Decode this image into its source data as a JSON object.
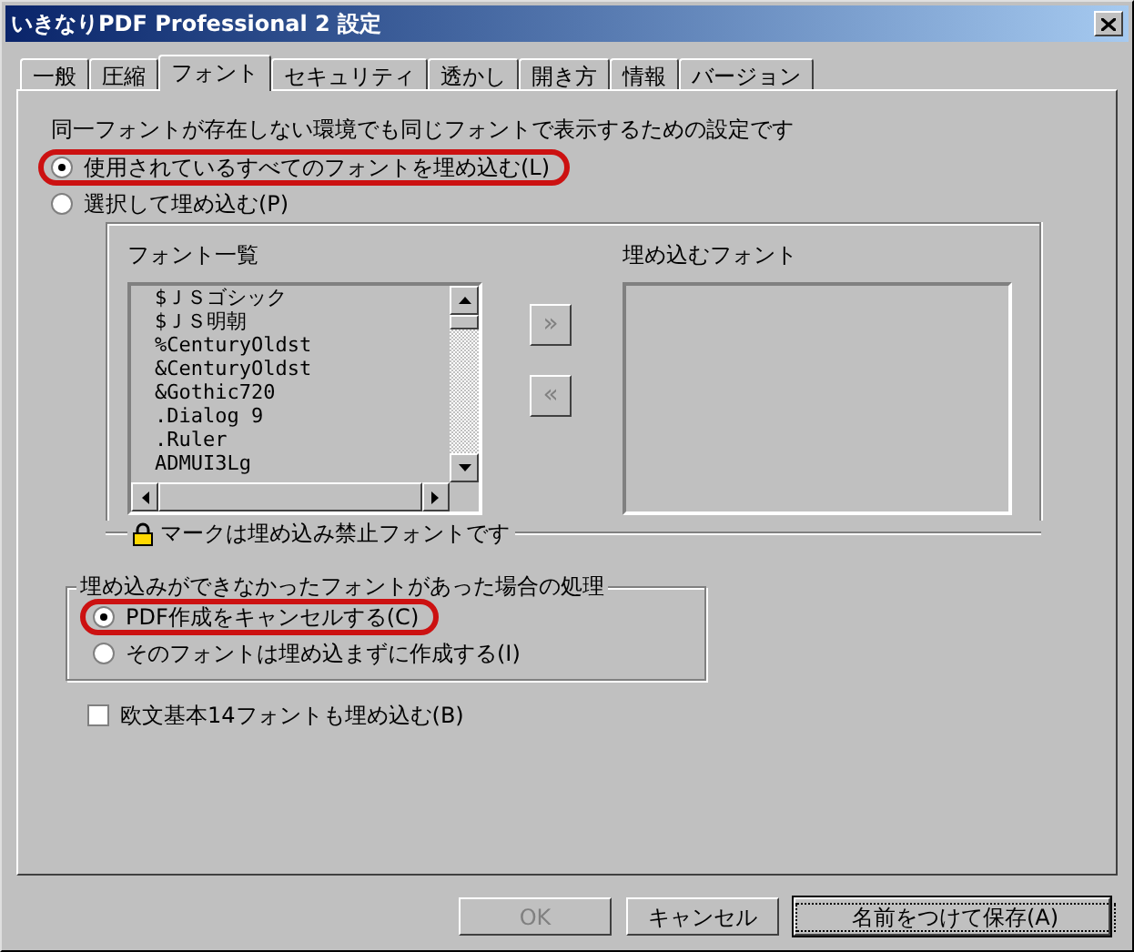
{
  "window": {
    "title": "いきなりPDF Professional 2 設定"
  },
  "tabs": [
    {
      "label": "一般",
      "selected": false
    },
    {
      "label": "圧縮",
      "selected": false
    },
    {
      "label": "フォント",
      "selected": true
    },
    {
      "label": "セキュリティ",
      "selected": false
    },
    {
      "label": "透かし",
      "selected": false
    },
    {
      "label": "開き方",
      "selected": false
    },
    {
      "label": "情報",
      "selected": false
    },
    {
      "label": "バージョン",
      "selected": false
    }
  ],
  "description": "同一フォントが存在しない環境でも同じフォントで表示するための設定です",
  "embed_options": [
    {
      "label": "使用されているすべてのフォントを埋め込む(L)",
      "selected": true,
      "highlighted": true
    },
    {
      "label": "選択して埋め込む(P)",
      "selected": false,
      "highlighted": false
    }
  ],
  "font_list": {
    "title": "フォント一覧",
    "items": [
      "$ＪＳゴシック",
      "$ＪＳ明朝",
      "%CenturyOldst",
      "&CenturyOldst",
      "&Gothic720",
      ".Dialog 9",
      ".Ruler",
      "ADMUI3Lg"
    ]
  },
  "move_buttons": [
    "»",
    "«"
  ],
  "embedded_list": {
    "title": "埋め込むフォント"
  },
  "lock_note": "マークは埋め込み禁止フォントです",
  "failure_group": {
    "title": "埋め込みができなかったフォントがあった場合の処理",
    "options": [
      {
        "label": "PDF作成をキャンセルする(C)",
        "selected": true,
        "highlighted": true
      },
      {
        "label": "そのフォントは埋め込まずに作成する(I)",
        "selected": false,
        "highlighted": false
      }
    ]
  },
  "base14": {
    "label": "欧文基本14フォントも埋め込む(B)",
    "checked": false
  },
  "buttons": [
    {
      "label": "OK",
      "disabled": true,
      "default": false
    },
    {
      "label": "キャンセル",
      "disabled": false,
      "default": false
    },
    {
      "label": "名前をつけて保存(A)",
      "disabled": false,
      "default": true
    }
  ]
}
